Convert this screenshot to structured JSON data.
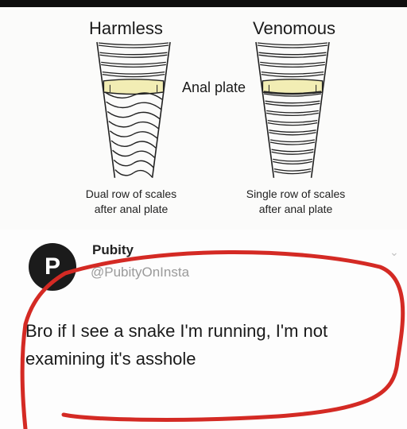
{
  "diagram": {
    "left_heading": "Harmless",
    "right_heading": "Venomous",
    "center_label": "Anal plate",
    "left_caption": [
      "Dual row of scales",
      "after anal plate"
    ],
    "right_caption": [
      "Single row of scales",
      "after anal plate"
    ],
    "plate_color": "#f2edb4",
    "outline_color": "#222222"
  },
  "post": {
    "avatar_glyph": "P",
    "name": "Pubity",
    "handle": "@PubityOnInsta",
    "text": "Bro if I see a snake I'm running, I'm not examining it's asshole",
    "annotation_color": "#d42a24"
  }
}
